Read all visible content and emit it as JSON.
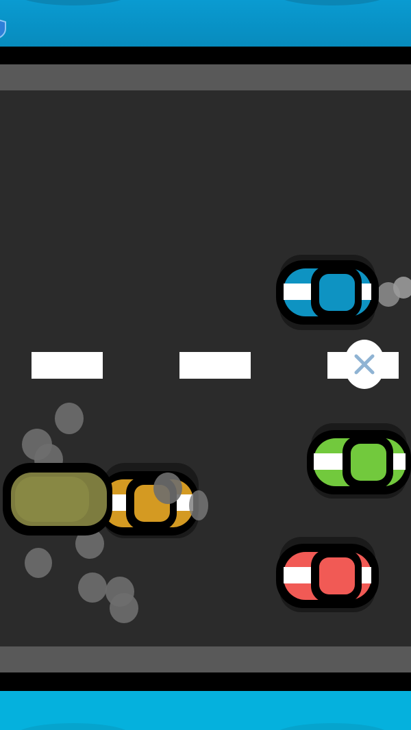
{
  "game": {
    "colors": {
      "header": "#0a9bd1",
      "footer": "#05b1dd",
      "road": "#2b2b2b",
      "curb": "#595959",
      "lane_marker": "#ffffff"
    },
    "icons": {
      "header_badge": "shield-icon",
      "close": "close-icon"
    },
    "cars": [
      {
        "name": "blue-car",
        "color": "#0e93c2"
      },
      {
        "name": "green-car",
        "color": "#72c93d"
      },
      {
        "name": "red-car",
        "color": "#f15a55"
      },
      {
        "name": "yellow-car",
        "color": "#d49a22"
      },
      {
        "name": "olive-truck",
        "color": "#7d7c3f"
      }
    ]
  }
}
